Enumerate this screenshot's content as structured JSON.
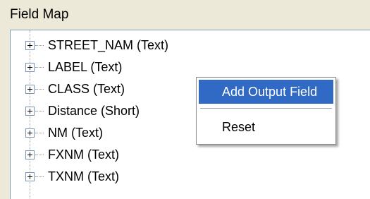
{
  "group": {
    "label": "Field Map"
  },
  "tree": {
    "items": [
      {
        "label": "STREET_NAM (Text)"
      },
      {
        "label": "LABEL (Text)"
      },
      {
        "label": "CLASS (Text)"
      },
      {
        "label": "Distance (Short)"
      },
      {
        "label": "NM (Text)"
      },
      {
        "label": "FXNM (Text)"
      },
      {
        "label": "TXNM (Text)"
      }
    ]
  },
  "context_menu": {
    "items": [
      {
        "label": "Add Output Field",
        "highlighted": true
      },
      {
        "label": "Reset",
        "highlighted": false
      }
    ],
    "highlight_color": "#316ac5"
  }
}
